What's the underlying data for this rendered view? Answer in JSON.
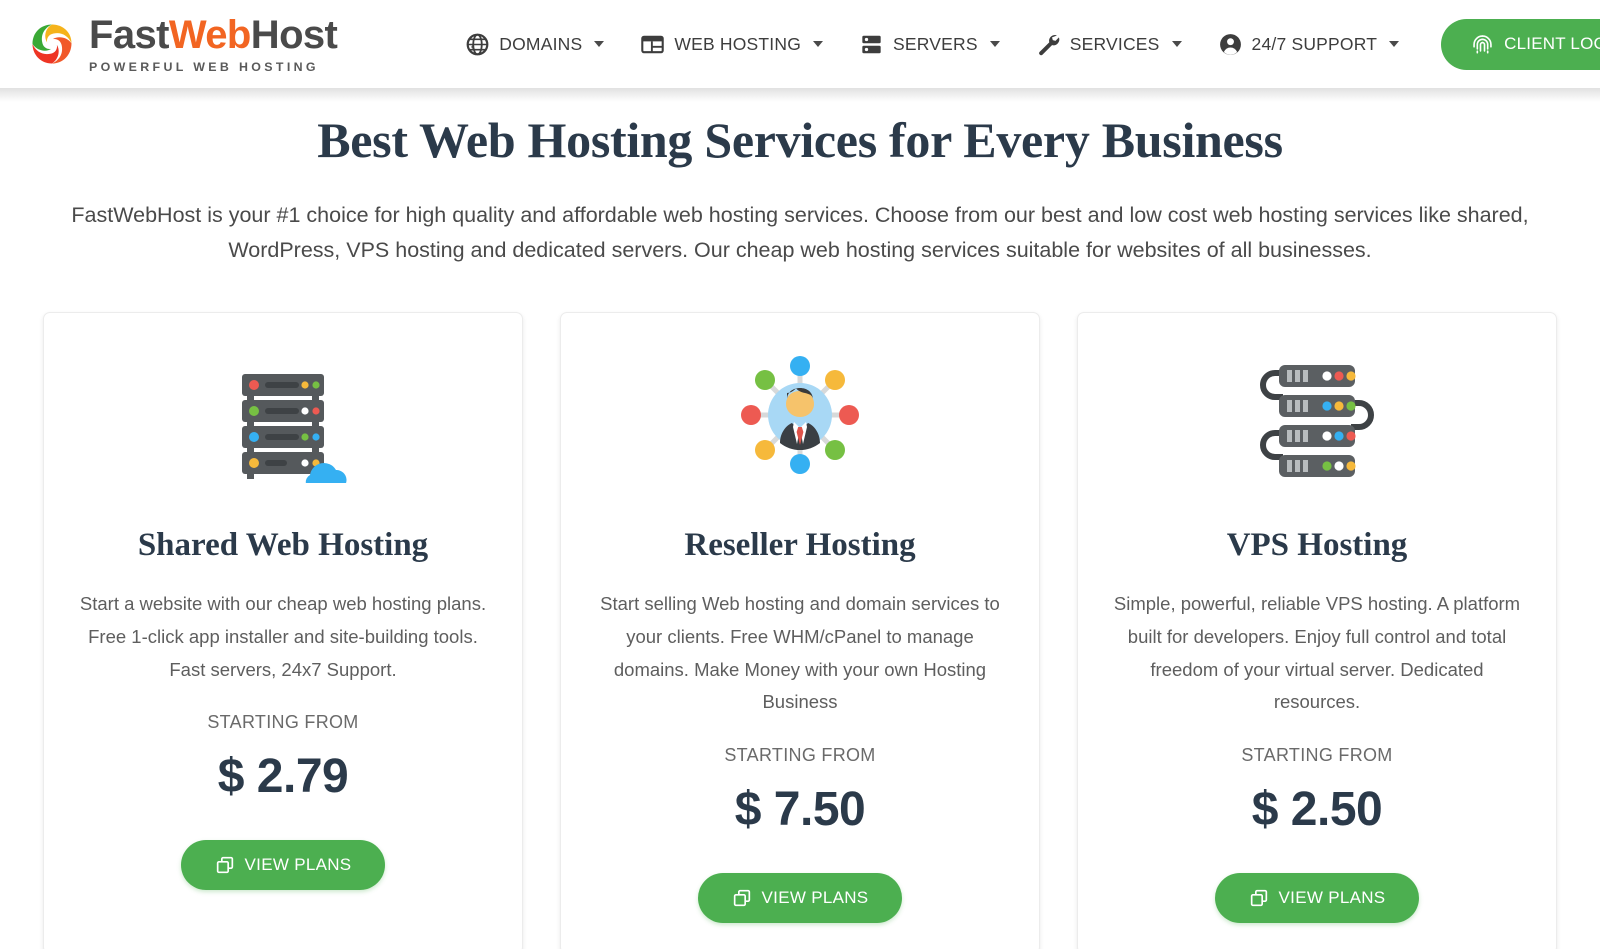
{
  "header": {
    "logo": {
      "icon": "fastwebhost-swirl-logo",
      "word_part1": "Fast",
      "word_part2": "Web",
      "word_part3": "Host",
      "tagline": "POWERFUL WEB HOSTING",
      "accent_color": "#f26522",
      "text_color": "#4a4a4a"
    },
    "nav": [
      {
        "label": "DOMAINS",
        "icon": "globe-icon",
        "has_caret": true
      },
      {
        "label": "WEB HOSTING",
        "icon": "browser-window-icon",
        "has_caret": true
      },
      {
        "label": "SERVERS",
        "icon": "server-rack-icon",
        "has_caret": true
      },
      {
        "label": "SERVICES",
        "icon": "wrench-icon",
        "has_caret": true
      },
      {
        "label": "24/7 SUPPORT",
        "icon": "user-circle-icon",
        "has_caret": true
      }
    ],
    "login_button": {
      "label": "CLIENT LOGIN",
      "icon": "fingerprint-icon",
      "color": "#4caf50"
    }
  },
  "hero": {
    "title": "Best Web Hosting Services for Every Business",
    "subtitle": "FastWebHost is your #1 choice for high quality and affordable web hosting services. Choose from our best and low cost web hosting services like shared, WordPress, VPS hosting and dedicated servers. Our cheap web hosting services suitable for websites of all businesses."
  },
  "cards": [
    {
      "icon": "server-stack-cloud-icon",
      "title": "Shared Web Hosting",
      "description": "Start a website with our cheap web hosting plans. Free 1-click app installer and site-building tools. Fast servers, 24x7 Support.",
      "price_label": "STARTING FROM",
      "price": "$ 2.79",
      "button_label": "VIEW PLANS",
      "button_icon": "copy-icon"
    },
    {
      "icon": "reseller-network-user-icon",
      "title": "Reseller Hosting",
      "description": "Start selling Web hosting and domain services to your clients. Free WHM/cPanel to manage domains. Make Money with your own Hosting Business",
      "price_label": "STARTING FROM",
      "price": "$ 7.50",
      "button_label": "VIEW PLANS",
      "button_icon": "copy-icon"
    },
    {
      "icon": "vps-server-cables-icon",
      "title": "VPS Hosting",
      "description": "Simple, powerful, reliable VPS hosting. A platform built for developers. Enjoy full control and total freedom of your virtual server. Dedicated resources.",
      "price_label": "STARTING FROM",
      "price": "$ 2.50",
      "button_label": "VIEW PLANS",
      "button_icon": "copy-icon"
    }
  ],
  "theme": {
    "brand_green": "#4caf50",
    "heading_navy": "#2b3a4a",
    "body_gray": "#5e5e5e",
    "logo_orange": "#f26522"
  }
}
